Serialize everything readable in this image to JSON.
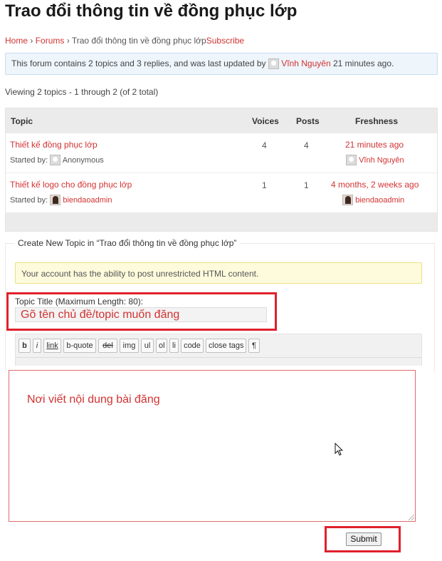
{
  "page_title": "Trao đổi thông tin về đồng phục lớp",
  "breadcrumb": {
    "home": "Home",
    "sep1": "›",
    "forums": "Forums",
    "sep2": "›",
    "current": "Trao đổi thông tin về đồng phục lớp",
    "subscribe": "Subscribe"
  },
  "info": {
    "prefix": "This forum contains 2 topics and 3 replies, and was last updated by",
    "user": "Vĩnh Nguyên",
    "time": "21 minutes ago."
  },
  "viewing": "Viewing 2 topics - 1 through 2 (of 2 total)",
  "table": {
    "headers": {
      "topic": "Topic",
      "voices": "Voices",
      "posts": "Posts",
      "freshness": "Freshness"
    },
    "rows": [
      {
        "title": "Thiết kế đồng phục lớp",
        "started_label": "Started by:",
        "author": "Anonymous",
        "voices": "4",
        "posts": "4",
        "freshness": "21 minutes ago",
        "last_user": "Vĩnh Nguyên"
      },
      {
        "title": "Thiết kế logo cho đồng phục lớp",
        "started_label": "Started by:",
        "author": "biendaoadmin",
        "voices": "1",
        "posts": "1",
        "freshness": "4 months, 2 weeks ago",
        "last_user": "biendaoadmin"
      }
    ]
  },
  "new_topic": {
    "legend": "Create New Topic in “Trao đổi thông tin về đồng phục lớp”",
    "notice": "Your account has the ability to post unrestricted HTML content.",
    "title_label": "Topic Title (Maximum Length: 80):",
    "title_value": "Gõ tên chủ đề/topic muốn đăng",
    "toolbar": [
      "b",
      "i",
      "link",
      "b-quote",
      "del",
      "img",
      "ul",
      "ol",
      "li",
      "code",
      "close tags",
      "¶"
    ],
    "editor_text": "Nơi viết nội dung bài đăng",
    "submit": "Submit"
  },
  "colors": {
    "accent": "#d23232",
    "highlight_box": "#e0202c"
  }
}
